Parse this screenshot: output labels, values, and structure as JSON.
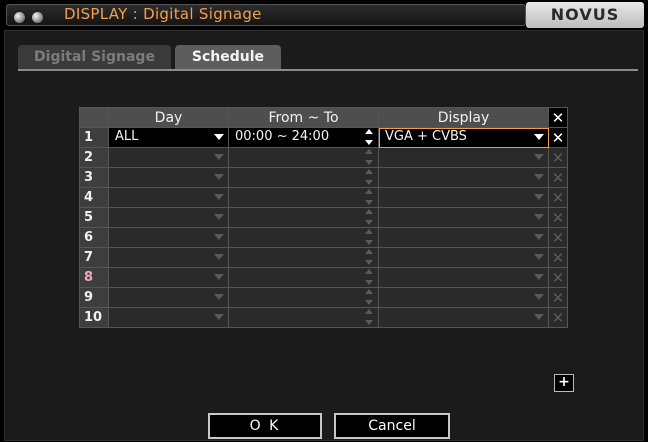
{
  "window": {
    "title": "DISPLAY : Digital Signage",
    "logo": "NOVUS",
    "colors": {
      "title_text": "#f2a050",
      "highlight": "#f0a040"
    }
  },
  "tabs": [
    {
      "label": "Digital Signage",
      "active": false
    },
    {
      "label": "Schedule",
      "active": true
    }
  ],
  "table": {
    "headers": {
      "day": "Day",
      "from_to": "From ~ To",
      "display": "Display",
      "delete": "✕"
    },
    "rows": [
      {
        "num": "1",
        "day": "ALL",
        "from_to": "00:00 ~ 24:00",
        "display": "VGA + CVBS",
        "active": true
      },
      {
        "num": "2",
        "day": "",
        "from_to": "",
        "display": "",
        "active": false
      },
      {
        "num": "3",
        "day": "",
        "from_to": "",
        "display": "",
        "active": false
      },
      {
        "num": "4",
        "day": "",
        "from_to": "",
        "display": "",
        "active": false
      },
      {
        "num": "5",
        "day": "",
        "from_to": "",
        "display": "",
        "active": false
      },
      {
        "num": "6",
        "day": "",
        "from_to": "",
        "display": "",
        "active": false
      },
      {
        "num": "7",
        "day": "",
        "from_to": "",
        "display": "",
        "active": false
      },
      {
        "num": "8",
        "day": "",
        "from_to": "",
        "display": "",
        "active": false
      },
      {
        "num": "9",
        "day": "",
        "from_to": "",
        "display": "",
        "active": false
      },
      {
        "num": "10",
        "day": "",
        "from_to": "",
        "display": "",
        "active": false
      }
    ],
    "add_label": "+",
    "delete_label": "✕"
  },
  "buttons": {
    "ok": "O K",
    "cancel": "Cancel"
  },
  "icons": {
    "dropdown": "triangle-down-icon",
    "spinner": "up-down-spinner-icon",
    "delete": "x-icon",
    "add": "plus-icon"
  }
}
